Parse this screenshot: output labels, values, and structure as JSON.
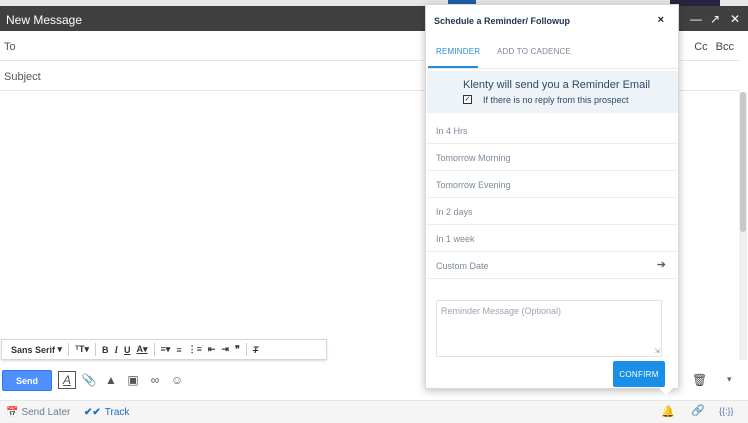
{
  "compose": {
    "title": "New Message",
    "to_label": "To",
    "cc_label": "Cc",
    "bcc_label": "Bcc",
    "subject_label": "Subject"
  },
  "toolbar": {
    "font_family": "Sans Serif",
    "items": [
      "font-size-icon",
      "bold-icon",
      "italic-icon",
      "underline-icon",
      "text-color-icon",
      "align-icon",
      "numbered-list-icon",
      "bulleted-list-icon",
      "indent-less-icon",
      "indent-more-icon",
      "quote-icon",
      "remove-formatting-icon"
    ]
  },
  "actions": {
    "send_label": "Send",
    "send_later_label": "Send Later",
    "track_label": "Track",
    "braces_label": "{{:}}"
  },
  "reminder": {
    "title": "Schedule a Reminder/ Followup",
    "close_label": "×",
    "tabs": [
      {
        "label": "REMINDER",
        "active": true
      },
      {
        "label": "ADD TO CADENCE",
        "active": false
      }
    ],
    "info_main": "Klenty will send you a Reminder Email",
    "info_sub": "If there is no reply from this prospect",
    "info_checked": true,
    "options": [
      {
        "label": "In 4 Hrs"
      },
      {
        "label": "Tomorrow Morning"
      },
      {
        "label": "Tomorrow Evening"
      },
      {
        "label": "In 2 days"
      },
      {
        "label": "In 1 week"
      },
      {
        "label": "Custom Date"
      }
    ],
    "message_placeholder": "Reminder Message (Optional)",
    "confirm_label": "CONFIRM"
  },
  "colors": {
    "header": "#404040",
    "send": "#4d90fe",
    "accent": "#2a8ad8",
    "confirm": "#1a8fe8"
  }
}
